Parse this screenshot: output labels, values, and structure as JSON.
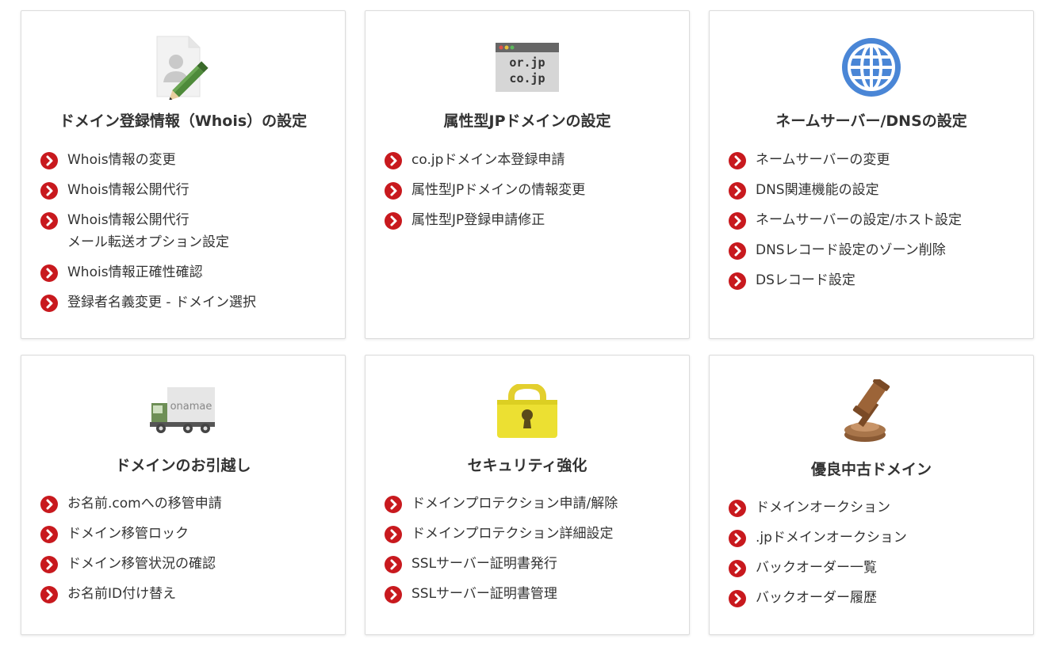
{
  "colors": {
    "accent": "#c8191e",
    "text": "#333333",
    "border": "#dcdcdc"
  },
  "cards": [
    {
      "title": "ドメイン登録情報（Whois）の設定",
      "icon": "document-pencil-icon",
      "items": [
        "Whois情報の変更",
        "Whois情報公開代行",
        "Whois情報公開代行\nメール転送オプション設定",
        "Whois情報正確性確認",
        "登録者名義変更 - ドメイン選択"
      ]
    },
    {
      "title": "属性型JPドメインの設定",
      "icon": "browser-window-icon",
      "icon_text": [
        "or.jp",
        "co.jp"
      ],
      "items": [
        "co.jpドメイン本登録申請",
        "属性型JPドメインの情報変更",
        "属性型JP登録申請修正"
      ]
    },
    {
      "title": "ネームサーバー/DNSの設定",
      "icon": "globe-icon",
      "items": [
        "ネームサーバーの変更",
        "DNS関連機能の設定",
        "ネームサーバーの設定/ホスト設定",
        "DNSレコード設定のゾーン削除",
        "DSレコード設定"
      ]
    },
    {
      "title": "ドメインのお引越し",
      "icon": "truck-icon",
      "icon_text": "onamae",
      "items": [
        "お名前.comへの移管申請",
        "ドメイン移管ロック",
        "ドメイン移管状況の確認",
        "お名前ID付け替え"
      ]
    },
    {
      "title": "セキュリティ強化",
      "icon": "padlock-icon",
      "items": [
        "ドメインプロテクション申請/解除",
        "ドメインプロテクション詳細設定",
        "SSLサーバー証明書発行",
        "SSLサーバー証明書管理"
      ]
    },
    {
      "title": "優良中古ドメイン",
      "icon": "gavel-icon",
      "items": [
        "ドメインオークション",
        ".jpドメインオークション",
        "バックオーダー一覧",
        "バックオーダー履歴"
      ]
    }
  ]
}
